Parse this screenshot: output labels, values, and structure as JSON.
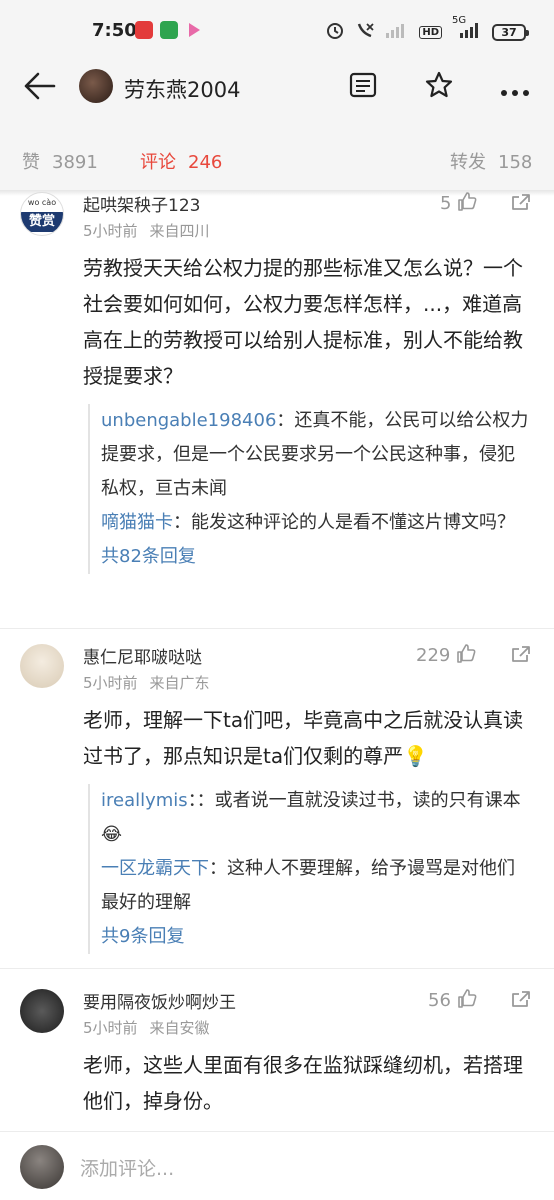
{
  "status": {
    "time": "7:50",
    "network": "5G",
    "battery": "37"
  },
  "header": {
    "title": "劳东燕2004",
    "icons": [
      "back-arrow-icon",
      "article-icon",
      "star-icon",
      "more-icon"
    ]
  },
  "tabs": [
    {
      "label": "赞",
      "count": "3891"
    },
    {
      "label": "评论",
      "count": "246"
    },
    {
      "label": "转发",
      "count": "158"
    }
  ],
  "comments": [
    {
      "name": "起哄架秧子123",
      "time": "5小时前",
      "location": "来自四川",
      "likes": "5",
      "avatar_text_top": "wo cào",
      "avatar_text_bottom": "赞赏",
      "text": "劳教授天天给公权力提的那些标准又怎么说？一个社会要如何如何，公权力要怎样怎样，...，难道高高在上的劳教授可以给别人提标准，别人不能给教授提要求？",
      "replies": [
        {
          "name": "unbengable198406",
          "text": "：还真不能，公民可以给公权力提要求，但是一个公民要求另一个公民这种事，侵犯私权，亘古未闻"
        },
        {
          "name": "嘀猫猫卡",
          "text": "：能发这种评论的人是看不懂这片博文吗？"
        }
      ],
      "more": "共82条回复"
    },
    {
      "name": "惠仁尼耶啵哒哒",
      "time": "5小时前",
      "location": "来自广东",
      "likes": "229",
      "text": "老师，理解一下ta们吧，毕竟高中之后就没认真读过书了，那点知识是ta们仅剩的尊严💡",
      "replies": [
        {
          "name": "ireallymis",
          "text": "：：或者说一直就没读过书，读的只有课本😂"
        },
        {
          "name": "一区龙霸天下",
          "text": "：这种人不要理解，给予谩骂是对他们最好的理解"
        }
      ],
      "more": "共9条回复"
    },
    {
      "name": "要用隔夜饭炒啊炒王",
      "time": "5小时前",
      "location": "来自安徽",
      "likes": "56",
      "text": "老师，这些人里面有很多在监狱踩缝纫机，若搭理他们，掉身份。"
    }
  ],
  "input": {
    "placeholder": "添加评论..."
  },
  "colors": {
    "accent": "#e8483c",
    "link": "#4a7fb5",
    "meta": "#999999"
  }
}
